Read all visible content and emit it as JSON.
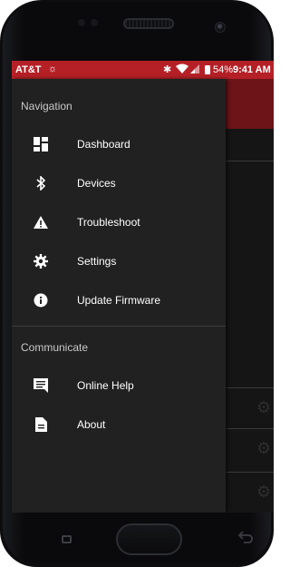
{
  "status_bar": {
    "carrier": "AT&T",
    "carrier_icon": "att-globe-icon",
    "bluetooth_icon": "bluetooth-icon",
    "wifi_icon": "wifi-icon",
    "signal_icon": "signal-icon",
    "battery_percent": "54%",
    "time": "9:41 AM",
    "bar_color": "#b52027"
  },
  "drawer": {
    "sections": [
      {
        "header": "Navigation",
        "items": [
          {
            "label": "Dashboard",
            "icon": "dashboard-grid-icon"
          },
          {
            "label": "Devices",
            "icon": "bluetooth-icon"
          },
          {
            "label": "Troubleshoot",
            "icon": "warning-triangle-icon"
          },
          {
            "label": "Settings",
            "icon": "gear-icon"
          },
          {
            "label": "Update Firmware",
            "icon": "info-circle-icon"
          }
        ]
      },
      {
        "header": "Communicate",
        "items": [
          {
            "label": "Online Help",
            "icon": "chat-bubble-icon"
          },
          {
            "label": "About",
            "icon": "document-icon"
          }
        ]
      }
    ]
  },
  "colors": {
    "accent": "#b52027",
    "toolbar_dim": "#6d1418",
    "drawer_bg": "#212121"
  }
}
